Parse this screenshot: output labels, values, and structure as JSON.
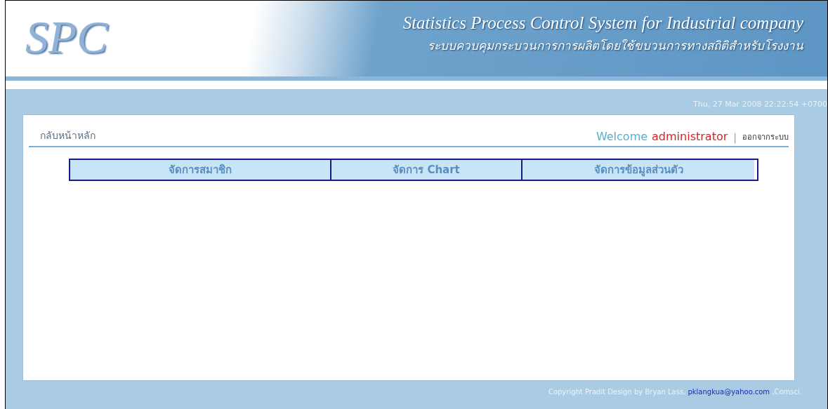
{
  "header": {
    "logo": "SPC",
    "title_en": "Statistics Process Control System for Industrial company",
    "title_th": "ระบบควบคุมกระบวนการการผลิตโดยใช้ขบวนการทางสถิติสำหรับโรงงาน"
  },
  "datetime": "Thu, 27 Mar 2008 22:22:54 +0700",
  "nav": {
    "home_link": "กลับหน้าหลัก",
    "welcome": "Welcome",
    "username": "administrator",
    "separator": "|",
    "logout_link": "ออกจากระบบ"
  },
  "menu": [
    {
      "label": "จัดการสมาชิก"
    },
    {
      "label": "จัดการ Chart"
    },
    {
      "label": "จัดการข้อมูลส่วนตัว"
    }
  ],
  "footer": {
    "copyright": "Copyright Pradit Design by Bryan Lass,",
    "email": "pklangkua@yahoo.com",
    "suffix": ",Comsci."
  }
}
